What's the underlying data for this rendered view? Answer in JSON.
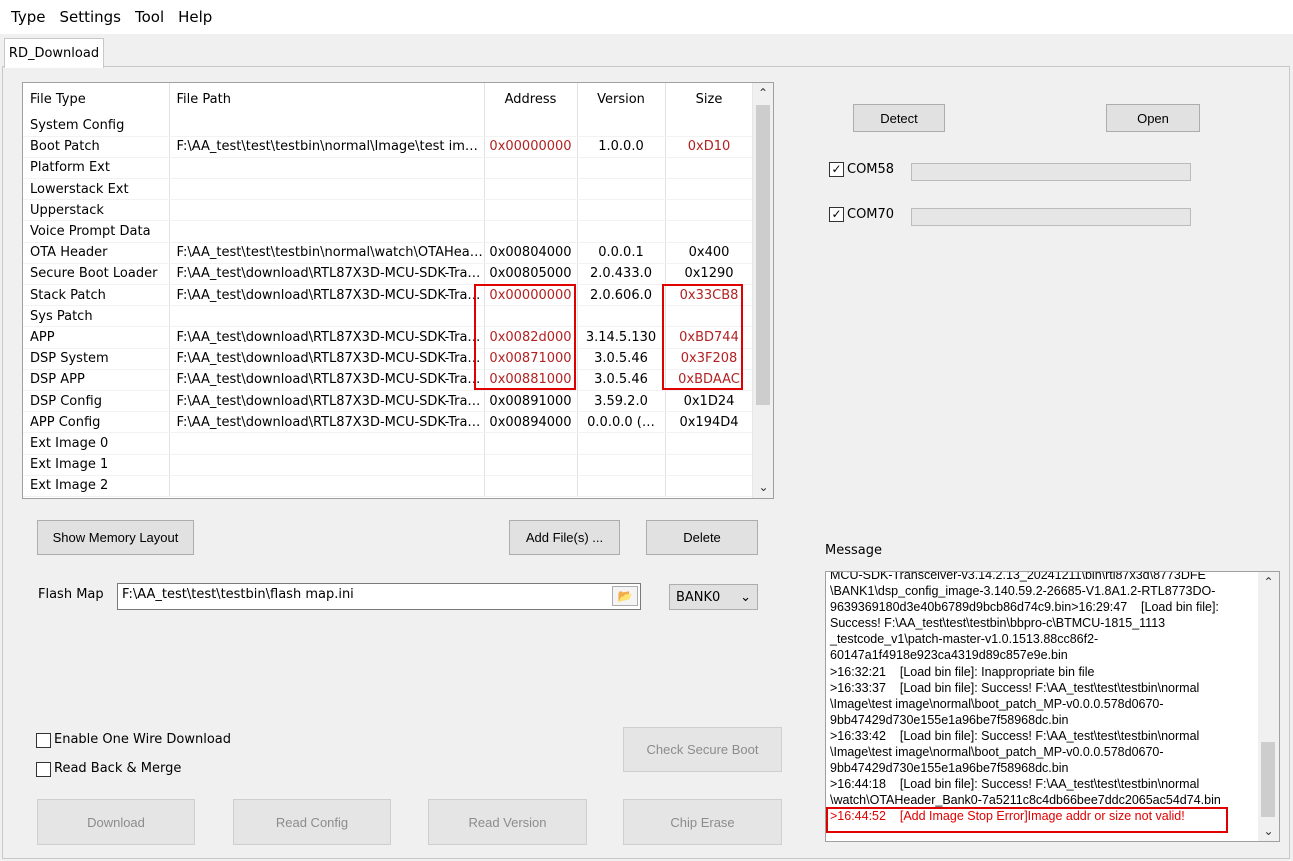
{
  "menu": [
    "Type",
    "Settings",
    "Tool",
    "Help"
  ],
  "tab": "RD_Download",
  "table": {
    "headers": [
      "File Type",
      "File Path",
      "Address",
      "Version",
      "Size"
    ],
    "rows": [
      {
        "type": "System Config",
        "path": "",
        "address": "",
        "version": "",
        "size": "",
        "red": false
      },
      {
        "type": "Boot Patch",
        "path": "F:\\AA_test\\test\\testbin\\normal\\Image\\test ima…",
        "address": "0x00000000",
        "version": "1.0.0.0",
        "size": "0xD10",
        "red": true
      },
      {
        "type": "Platform Ext",
        "path": "",
        "address": "",
        "version": "",
        "size": "",
        "red": false
      },
      {
        "type": "Lowerstack Ext",
        "path": "",
        "address": "",
        "version": "",
        "size": "",
        "red": false
      },
      {
        "type": "Upperstack",
        "path": "",
        "address": "",
        "version": "",
        "size": "",
        "red": false
      },
      {
        "type": "Voice Prompt Data",
        "path": "",
        "address": "",
        "version": "",
        "size": "",
        "red": false
      },
      {
        "type": "OTA Header",
        "path": "F:\\AA_test\\test\\testbin\\normal\\watch\\OTAHea…",
        "address": "0x00804000",
        "version": "0.0.0.1",
        "size": "0x400",
        "red": false
      },
      {
        "type": "Secure Boot Loader",
        "path": "F:\\AA_test\\download\\RTL87X3D-MCU-SDK-Tra…",
        "address": "0x00805000",
        "version": "2.0.433.0",
        "size": "0x1290",
        "red": false
      },
      {
        "type": "Stack Patch",
        "path": "F:\\AA_test\\download\\RTL87X3D-MCU-SDK-Tra…",
        "address": "0x00000000",
        "version": "2.0.606.0",
        "size": "0x33CB8",
        "red": true
      },
      {
        "type": "Sys Patch",
        "path": "",
        "address": "",
        "version": "",
        "size": "",
        "red": false
      },
      {
        "type": "APP",
        "path": "F:\\AA_test\\download\\RTL87X3D-MCU-SDK-Tra…",
        "address": "0x0082d000",
        "version": "3.14.5.130",
        "size": "0xBD744",
        "red": true
      },
      {
        "type": "DSP System",
        "path": "F:\\AA_test\\download\\RTL87X3D-MCU-SDK-Tra…",
        "address": "0x00871000",
        "version": "3.0.5.46",
        "size": "0x3F208",
        "red": true
      },
      {
        "type": "DSP APP",
        "path": "F:\\AA_test\\download\\RTL87X3D-MCU-SDK-Tra…",
        "address": "0x00881000",
        "version": "3.0.5.46",
        "size": "0xBDAAC",
        "red": true
      },
      {
        "type": "DSP Config",
        "path": "F:\\AA_test\\download\\RTL87X3D-MCU-SDK-Tra…",
        "address": "0x00891000",
        "version": "3.59.2.0",
        "size": "0x1D24",
        "red": false
      },
      {
        "type": "APP Config",
        "path": "F:\\AA_test\\download\\RTL87X3D-MCU-SDK-Tra…",
        "address": "0x00894000",
        "version": "0.0.0.0 (…",
        "size": "0x194D4",
        "red": false
      },
      {
        "type": "Ext Image 0",
        "path": "",
        "address": "",
        "version": "",
        "size": "",
        "red": false
      },
      {
        "type": "Ext Image 1",
        "path": "",
        "address": "",
        "version": "",
        "size": "",
        "red": false
      },
      {
        "type": "Ext Image 2",
        "path": "",
        "address": "",
        "version": "",
        "size": "",
        "red": false
      }
    ]
  },
  "buttons": {
    "detect": "Detect",
    "open": "Open",
    "show_memory_layout": "Show Memory Layout",
    "add_files": "Add File(s) ...",
    "delete": "Delete",
    "check_secure_boot": "Check Secure Boot",
    "download": "Download",
    "read_config": "Read Config",
    "read_version": "Read Version",
    "chip_erase": "Chip Erase"
  },
  "ports": [
    {
      "label": "COM58",
      "checked": true
    },
    {
      "label": "COM70",
      "checked": true
    }
  ],
  "flash_map": {
    "label": "Flash Map",
    "value": "F:\\AA_test\\test\\testbin\\flash map.ini",
    "bank": "BANK0"
  },
  "options": {
    "one_wire": "Enable One Wire Download",
    "read_back": "Read Back & Merge"
  },
  "message": {
    "label": "Message",
    "lines": [
      "MCU-SDK-Transceiver-v3.14.2.13_20241211\\bin\\rtl87x3d\\8773DFE",
      "\\BANK1\\dsp_config_image-3.140.59.2-26685-V1.8A1.2-RTL8773DO-",
      "9639369180d3e40b6789d9bcb86d74c9.bin>16:29:47    [Load bin file]:",
      "Success! F:\\AA_test\\test\\testbin\\bbpro-c\\BTMCU-1815_1113",
      "_testcode_v1\\patch-master-v1.0.1513.88cc86f2-",
      "60147a1f4918e923ca4319d89c857e9e.bin",
      ">16:32:21    [Load bin file]: Inappropriate bin file",
      ">16:33:37    [Load bin file]: Success! F:\\AA_test\\test\\testbin\\normal",
      "\\Image\\test image\\normal\\boot_patch_MP-v0.0.0.578d0670-",
      "9bb47429d730e155e1a96be7f58968dc.bin",
      ">16:33:42    [Load bin file]: Success! F:\\AA_test\\test\\testbin\\normal",
      "\\Image\\test image\\normal\\boot_patch_MP-v0.0.0.578d0670-",
      "9bb47429d730e155e1a96be7f58968dc.bin",
      ">16:44:18    [Load bin file]: Success! F:\\AA_test\\test\\testbin\\normal",
      "\\watch\\OTAHeader_Bank0-7a5211c8c4db66bee7ddc2065ac54d74.bin",
      ">16:44:52    [Add Image Stop Error]Image addr or size not valid!"
    ],
    "error_line_index": 15
  },
  "colors": {
    "highlight_box": "#e10000",
    "red_value_text": "#b22222",
    "error_text": "#e00000"
  }
}
